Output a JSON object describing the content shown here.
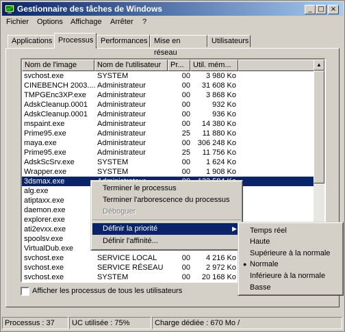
{
  "window": {
    "title": "Gestionnaire des tâches de Windows"
  },
  "menu": [
    "Fichier",
    "Options",
    "Affichage",
    "Arrêter",
    "?"
  ],
  "tabs": [
    "Applications",
    "Processus",
    "Performances",
    "Mise en réseau",
    "Utilisateurs"
  ],
  "columns": [
    "Nom de l'image",
    "Nom de l'utilisateur",
    "Pr...",
    "Util. mém..."
  ],
  "rows": [
    [
      "svchost.exe",
      "SYSTEM",
      "00",
      "3 980 Ko"
    ],
    [
      "CINEBENCH 2003....",
      "Administrateur",
      "00",
      "31 608 Ko"
    ],
    [
      "TMPGEnc3XP.exe",
      "Administrateur",
      "00",
      "3 868 Ko"
    ],
    [
      "AdskCleanup.0001",
      "Administrateur",
      "00",
      "932 Ko"
    ],
    [
      "AdskCleanup.0001",
      "Administrateur",
      "00",
      "936 Ko"
    ],
    [
      "mspaint.exe",
      "Administrateur",
      "00",
      "14 380 Ko"
    ],
    [
      "Prime95.exe",
      "Administrateur",
      "25",
      "11 880 Ko"
    ],
    [
      "maya.exe",
      "Administrateur",
      "00",
      "306 248 Ko"
    ],
    [
      "Prime95.exe",
      "Administrateur",
      "25",
      "11 756 Ko"
    ],
    [
      "AdskScSrv.exe",
      "SYSTEM",
      "00",
      "1 624 Ko"
    ],
    [
      "Wrapper.exe",
      "SYSTEM",
      "00",
      "1 908 Ko"
    ],
    [
      "3dsmax.exe",
      "Administrateur",
      "00",
      "132 584 Ko"
    ],
    [
      "alg.exe",
      "",
      "",
      ""
    ],
    [
      "atiptaxx.exe",
      "",
      "",
      ""
    ],
    [
      "daemon.exe",
      "",
      "",
      ""
    ],
    [
      "explorer.exe",
      "",
      "",
      ""
    ],
    [
      "ati2evxx.exe",
      "",
      "",
      ""
    ],
    [
      "spoolsv.exe",
      "",
      "",
      ""
    ],
    [
      "VirtualDub.exe",
      "",
      "",
      ""
    ],
    [
      "svchost.exe",
      "SERVICE LOCAL",
      "00",
      "4 216 Ko"
    ],
    [
      "svchost.exe",
      "SERVICE RÉSEAU",
      "00",
      "2 972 Ko"
    ],
    [
      "svchost.exe",
      "SYSTEM",
      "00",
      "20 168 Ko"
    ]
  ],
  "checkbox_label": "Afficher les processus de tous les utilisateurs",
  "status": {
    "processes": "Processus : 37",
    "cpu": "UC utilisée : 75%",
    "commit": "Charge dédiée : 670 Mo /"
  },
  "context_menu": [
    "Terminer le processus",
    "Terminer l'arborescence du processus",
    "Déboguer",
    "Définir la priorité",
    "Définir l'affinité..."
  ],
  "priority_menu": [
    "Temps réel",
    "Haute",
    "Supérieure à la normale",
    "Normale",
    "Inférieure à la normale",
    "Basse"
  ],
  "icons": {
    "app": "task-manager-icon",
    "minimize": "minimize-icon",
    "maximize": "maximize-icon",
    "close": "close-icon",
    "submenu": "chevron-right-icon",
    "radio": "radio-bullet-icon"
  }
}
